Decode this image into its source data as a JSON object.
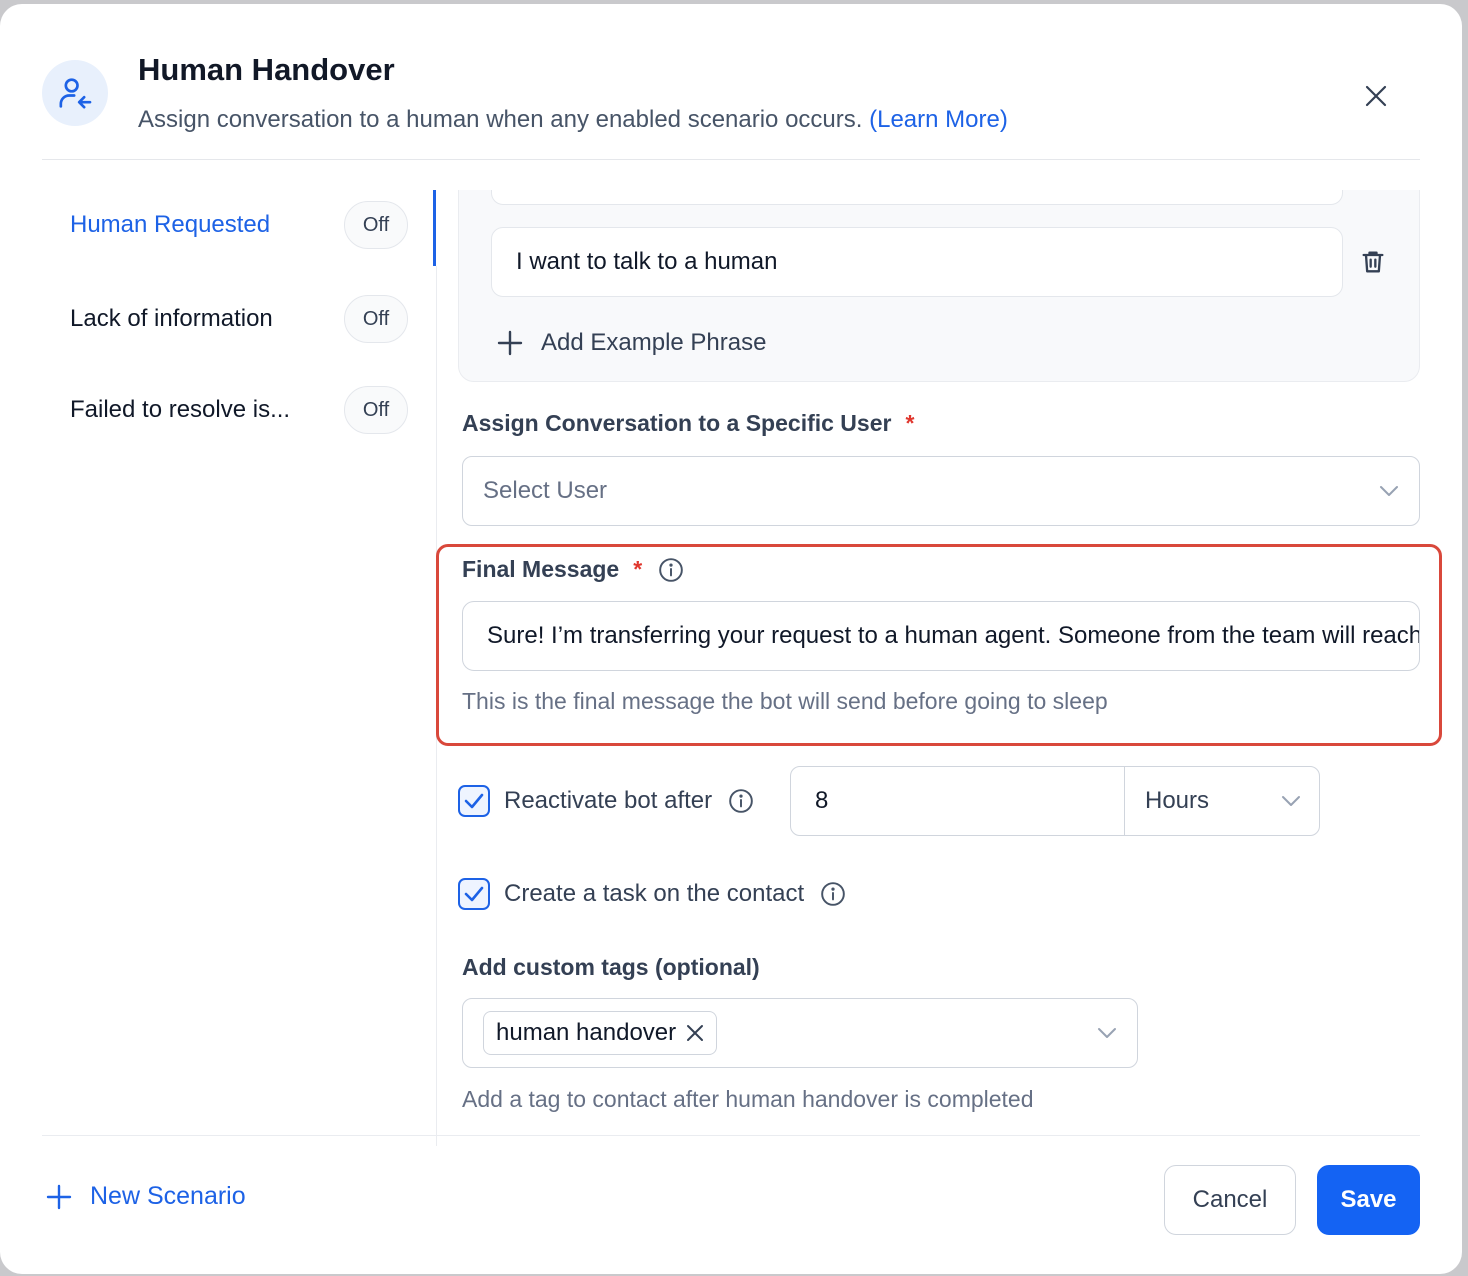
{
  "header": {
    "title": "Human Handover",
    "subtitle": "Assign conversation to a human when any enabled scenario occurs.",
    "learn_more": "(Learn More)"
  },
  "sidebar": {
    "items": [
      {
        "label": "Human Requested",
        "status": "Off",
        "active": true
      },
      {
        "label": "Lack of information",
        "status": "Off",
        "active": false
      },
      {
        "label": "Failed to resolve is...",
        "status": "Off",
        "active": false
      }
    ]
  },
  "phrases": {
    "items": [
      "",
      "I want to talk to a human"
    ],
    "add_label": "Add Example Phrase"
  },
  "assign_user": {
    "label": "Assign Conversation to a Specific User",
    "required": "*",
    "placeholder": "Select User"
  },
  "final_message": {
    "label": "Final Message",
    "required": "*",
    "value": "Sure! I’m transferring your request to a human agent. Someone from the team will reach out shortly.",
    "hint": "This is the final message the bot will send before going to sleep"
  },
  "reactivate": {
    "label": "Reactivate bot after",
    "checked": true,
    "value": "8",
    "unit": "Hours"
  },
  "create_task": {
    "label": "Create a task on the contact",
    "checked": true
  },
  "custom_tags": {
    "label": "Add custom tags (optional)",
    "tags": [
      "human handover"
    ],
    "hint": "Add a tag to contact after human handover is completed"
  },
  "footer": {
    "new_scenario": "New Scenario",
    "cancel": "Cancel",
    "save": "Save"
  },
  "colors": {
    "accent": "#1463f3",
    "link": "#1d62e6",
    "required": "#e0372e",
    "highlight": "#d9483b"
  }
}
